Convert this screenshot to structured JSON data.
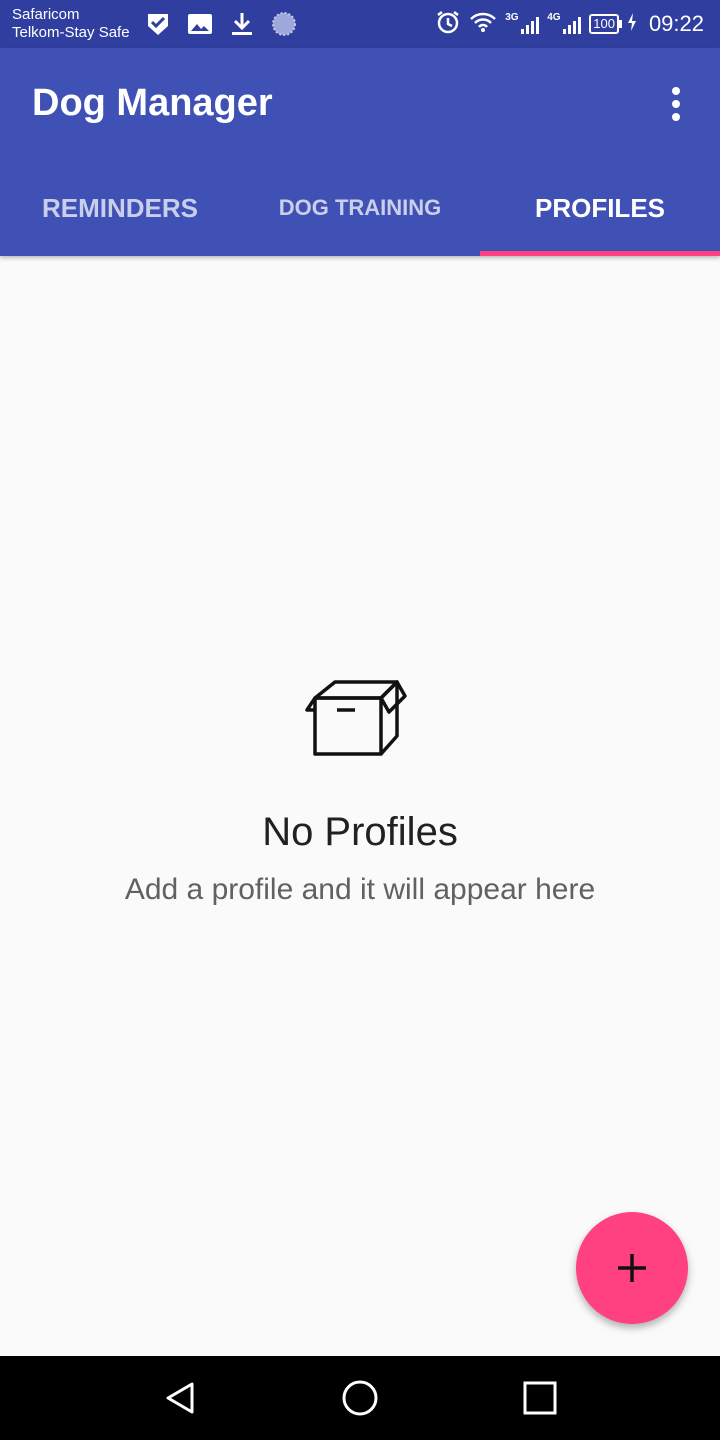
{
  "status_bar": {
    "carrier_1": "Safaricom",
    "carrier_2": "Telkom-Stay Safe",
    "signal_1_label": "3G",
    "signal_2_label": "4G",
    "battery": "100",
    "time": "09:22",
    "color": "#303f9f"
  },
  "app_bar": {
    "title": "Dog Manager",
    "color": "#3f51b5"
  },
  "tabs": [
    {
      "label": "REMINDERS",
      "active": false
    },
    {
      "label": "DOG TRAINING",
      "active": false
    },
    {
      "label": "PROFILES",
      "active": true
    }
  ],
  "empty_state": {
    "icon": "box-icon",
    "title": "No Profiles",
    "subtitle": "Add a profile and it will appear here"
  },
  "fab": {
    "icon": "plus-icon",
    "color": "#ff4081"
  },
  "nav_bar": {
    "icons": [
      "back-icon",
      "home-icon",
      "recents-icon"
    ]
  }
}
